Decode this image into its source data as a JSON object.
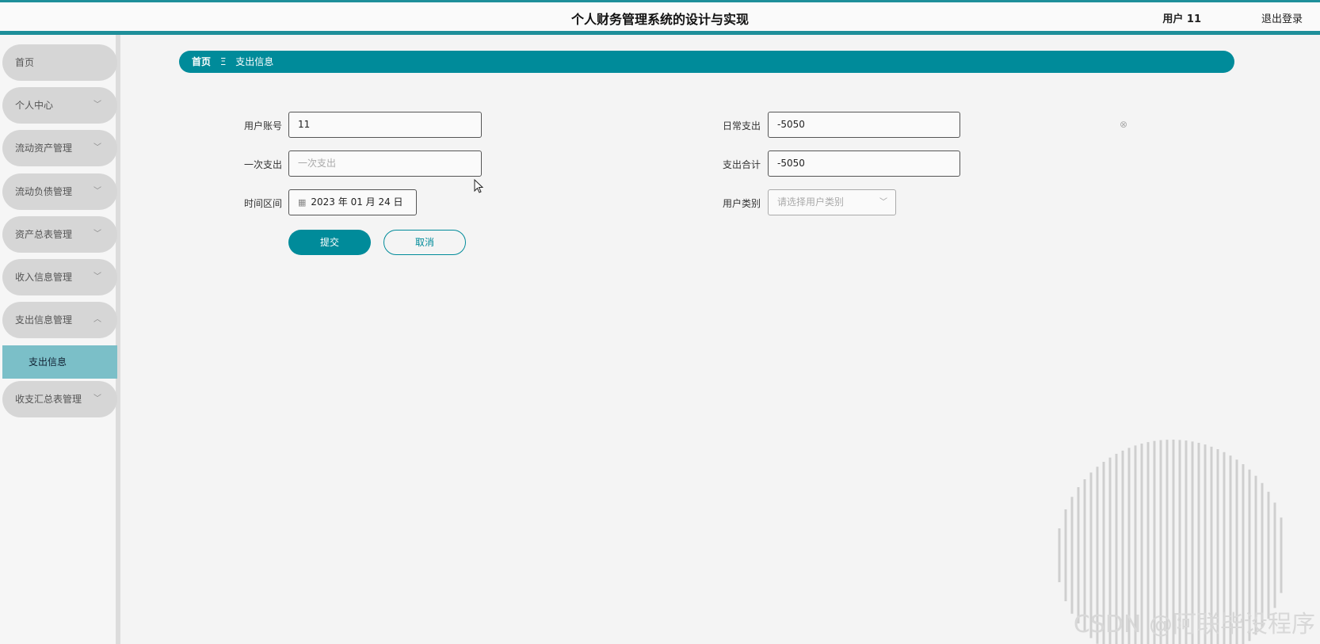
{
  "header": {
    "title": "个人财务管理系统的设计与实现",
    "user": "用户 11",
    "logout": "退出登录"
  },
  "sidebar": {
    "items": [
      {
        "label": "首页"
      },
      {
        "label": "个人中心",
        "chevron": "﹀"
      },
      {
        "label": "流动资产管理",
        "chevron": "﹀"
      },
      {
        "label": "流动负债管理",
        "chevron": "﹀"
      },
      {
        "label": "资产总表管理",
        "chevron": "﹀"
      },
      {
        "label": "收入信息管理",
        "chevron": "﹀"
      },
      {
        "label": "支出信息管理",
        "chevron": "︿"
      },
      {
        "label": "收支汇总表管理",
        "chevron": "﹀"
      }
    ],
    "sub_item": "支出信息"
  },
  "breadcrumb": {
    "home": "首页",
    "separator": "Ξ",
    "current": "支出信息"
  },
  "form": {
    "account": {
      "label": "用户账号",
      "value": "11"
    },
    "daily_expense": {
      "label": "日常支出",
      "value": "-5050"
    },
    "one_time": {
      "label": "一次支出",
      "placeholder": "一次支出"
    },
    "total": {
      "label": "支出合计",
      "value": "-5050"
    },
    "period": {
      "label": "时间区间",
      "value": "2023 年 01 月 24 日"
    },
    "user_type": {
      "label": "用户类别",
      "placeholder": "请选择用户类别"
    },
    "submit": "提交",
    "cancel": "取消"
  },
  "watermark": "CSDN @阿联毕设程序",
  "colors": {
    "accent": "#008b9a",
    "active_sub": "#7bbfc8"
  }
}
